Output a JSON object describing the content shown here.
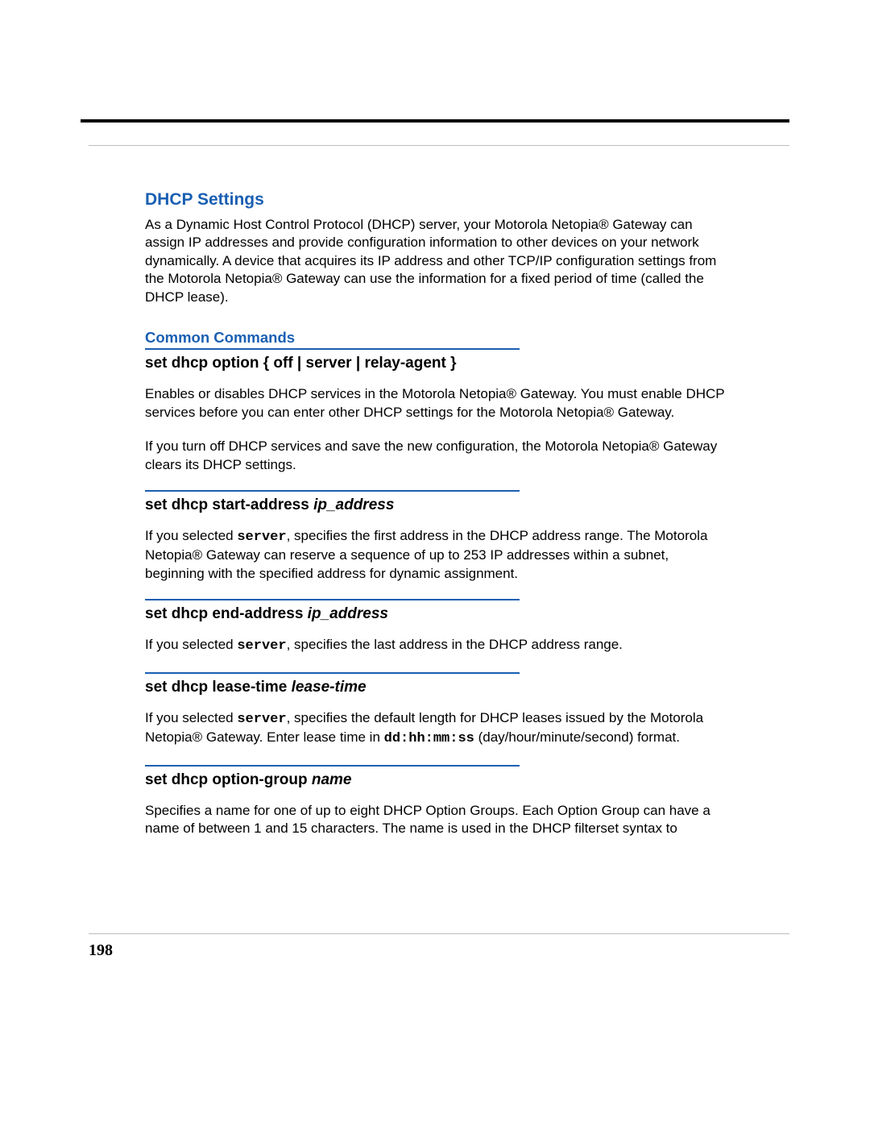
{
  "page_number": "198",
  "section_title": "DHCP Settings",
  "intro": "As a Dynamic Host Control Protocol (DHCP) server, your Motorola Netopia® Gateway can assign IP addresses and provide configuration information to other devices on your network dynamically. A device that acquires its IP address and other TCP/IP configuration settings from the Motorola Netopia® Gateway can use the information for a fixed period of time (called the DHCP lease).",
  "subsection_title": "Common Commands",
  "commands": [
    {
      "head_plain": "set dhcp option { off | server | relay-agent }",
      "p1": "Enables or disables DHCP services in the Motorola Netopia® Gateway. You must enable DHCP services before you can enter other DHCP settings for the Motorola Netopia® Gateway.",
      "p2": "If you turn off DHCP services and save the new configuration, the Motorola Netopia® Gateway clears its DHCP settings."
    },
    {
      "head_prefix": "set dhcp start-address ",
      "head_arg": "ip_address",
      "p1_prefix": "If you selected  ",
      "p1_mono": "server",
      "p1_suffix": ", specifies the first address in the DHCP address range. The Motorola Netopia® Gateway can reserve a sequence of up to 253 IP addresses within a subnet, beginning with the specified address for dynamic assignment."
    },
    {
      "head_prefix": "set dhcp end-address ",
      "head_arg": "ip_address",
      "p1_prefix": "If you selected ",
      "p1_mono": "server",
      "p1_suffix": ", specifies the last address in the DHCP address range."
    },
    {
      "head_prefix": "set dhcp lease-time ",
      "head_arg": "lease-time",
      "p1_prefix": "If you selected ",
      "p1_mono": "server",
      "p1_suffix": ", specifies the default length for DHCP leases issued by the Motorola Netopia® Gateway. Enter lease time in ",
      "p1_mono2": "dd:hh:mm:ss",
      "p1_suffix2": " (day/hour/minute/second) format."
    },
    {
      "head_prefix": "set dhcp option-group ",
      "head_arg": "name",
      "p1": "Specifies a name for one of up to eight DHCP Option Groups. Each Option Group can have a name of between 1 and 15 characters. The name is used in the DHCP filterset syntax to"
    }
  ]
}
